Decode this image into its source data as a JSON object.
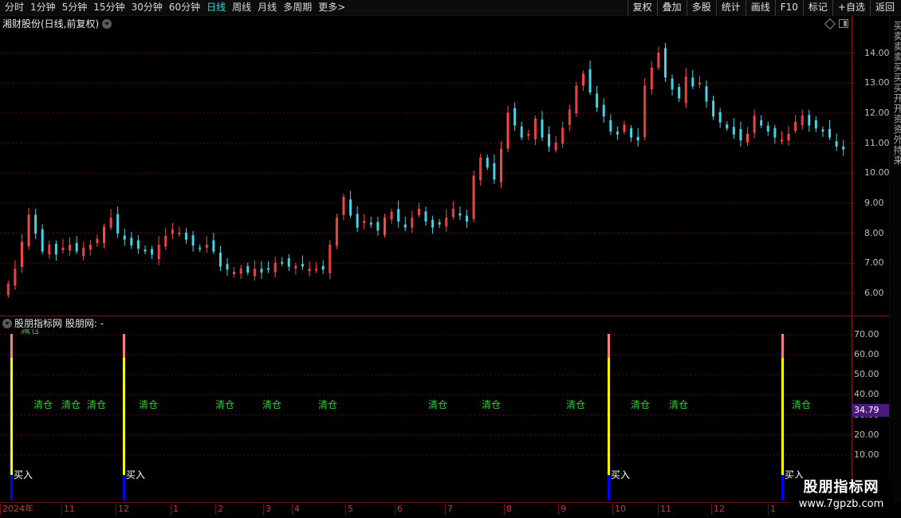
{
  "toolbar": {
    "periods": [
      "分时",
      "1分钟",
      "5分钟",
      "15分钟",
      "30分钟",
      "60分钟",
      "日线",
      "周线",
      "月线",
      "多周期",
      "更多"
    ],
    "active_period": "日线",
    "more_arrow": ">",
    "buttons": [
      "复权",
      "叠加",
      "多股",
      "统计",
      "画线",
      "F10",
      "标记",
      "+自选",
      "返回"
    ]
  },
  "main_chart": {
    "title": "湘财股份(日线,前复权)",
    "y_ticks": [
      "14.00",
      "13.00",
      "12.00",
      "11.00",
      "10.00",
      "9.00",
      "8.00",
      "7.00",
      "6.00"
    ]
  },
  "indicator": {
    "title": "股朋指标网 股朋网: -",
    "current_value": "34.79",
    "y_ticks": [
      "70.00",
      "60.00",
      "50.00",
      "40.00",
      "30.00",
      "20.00",
      "10.00"
    ],
    "clear_label": "清仓",
    "buy_label": "买入",
    "top_label": "减仓"
  },
  "side_panel": {
    "text": "买卖卖卖买买买开开资资外持来"
  },
  "x_axis": {
    "months": [
      "2024年",
      "11",
      "12",
      "1",
      "2",
      "3",
      "4",
      "5",
      "6",
      "7",
      "8",
      "9",
      "10",
      "11",
      "12",
      "1"
    ]
  },
  "watermark": {
    "title": "股朋指标网",
    "url": "www.7gpzb.com"
  },
  "colors": {
    "up": "#ff4848",
    "down": "#45d3e6",
    "grid": "#5a0e0e",
    "clear_signal": "#2fd02f",
    "signal_blue": "#0000ff",
    "signal_yellow": "#ffff00",
    "signal_pink": "#ff8080"
  },
  "chart_data": {
    "type": "candlestick",
    "y_range": [
      5.6,
      14.6
    ],
    "close_prices": [
      6.3,
      6.8,
      7.7,
      8.6,
      8.0,
      7.4,
      7.6,
      7.3,
      7.5,
      7.6,
      7.4,
      7.5,
      7.6,
      7.8,
      8.2,
      8.5,
      8.0,
      7.8,
      7.6,
      7.5,
      7.4,
      7.3,
      7.6,
      7.9,
      8.1,
      8.0,
      7.8,
      7.6,
      7.5,
      7.6,
      7.4,
      6.9,
      6.8,
      6.7,
      6.8,
      6.7,
      6.8,
      6.7,
      6.8,
      7.0,
      7.0,
      6.9,
      6.9,
      6.9,
      6.8,
      6.8,
      6.8,
      7.6,
      8.5,
      9.2,
      8.6,
      8.2,
      8.4,
      8.3,
      8.1,
      8.5,
      8.7,
      8.4,
      8.2,
      8.5,
      8.8,
      8.4,
      8.2,
      8.3,
      8.5,
      8.8,
      8.6,
      8.4,
      9.9,
      10.5,
      10.2,
      9.8,
      10.8,
      12.0,
      11.6,
      11.2,
      11.3,
      11.8,
      11.2,
      10.9,
      11.0,
      11.5,
      12.1,
      12.9,
      13.3,
      12.7,
      12.2,
      11.9,
      11.4,
      11.3,
      11.6,
      11.2,
      11.1,
      12.9,
      13.5,
      14.0,
      13.2,
      12.8,
      12.5,
      13.2,
      12.9,
      13.0,
      12.4,
      11.9,
      11.7,
      11.5,
      11.3,
      11.1,
      11.3,
      11.9,
      11.6,
      11.4,
      11.2,
      11.1,
      11.3,
      11.7,
      11.9,
      11.6,
      11.5,
      11.4,
      11.2,
      10.9,
      10.8
    ]
  }
}
